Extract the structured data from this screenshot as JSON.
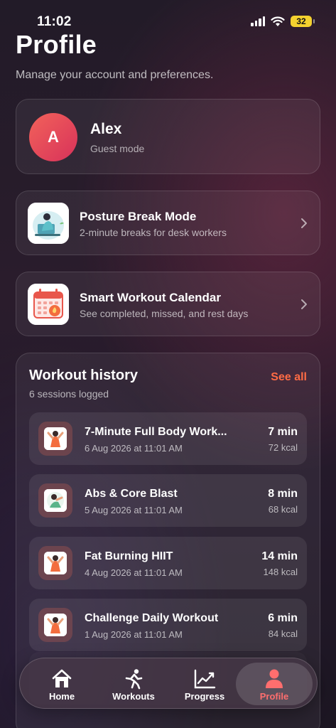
{
  "status_bar": {
    "time": "11:02",
    "battery": "32"
  },
  "header": {
    "title": "Profile",
    "subtitle": "Manage your account and preferences."
  },
  "profile": {
    "initial": "A",
    "name": "Alex",
    "status": "Guest mode"
  },
  "features": [
    {
      "title": "Posture Break Mode",
      "description": "2-minute breaks for desk workers",
      "icon": "posture-illustration-icon"
    },
    {
      "title": "Smart Workout Calendar",
      "description": "See completed, missed, and rest days",
      "icon": "calendar-icon"
    }
  ],
  "history": {
    "title": "Workout history",
    "count": "6 sessions logged",
    "see_all": "See all",
    "sessions": [
      {
        "name": "7-Minute Full Body Work...",
        "date": "6 Aug 2026 at 11:01 AM",
        "duration": "7 min",
        "kcal": "72 kcal"
      },
      {
        "name": "Abs & Core Blast",
        "date": "5 Aug 2026 at 11:01 AM",
        "duration": "8 min",
        "kcal": "68 kcal"
      },
      {
        "name": "Fat Burning HIIT",
        "date": "4 Aug 2026 at 11:01 AM",
        "duration": "14 min",
        "kcal": "148 kcal"
      },
      {
        "name": "Challenge Daily Workout",
        "date": "1 Aug 2026 at 11:01 AM",
        "duration": "6 min",
        "kcal": "84 kcal"
      }
    ]
  },
  "tabs": [
    {
      "label": "Home",
      "icon": "home-icon"
    },
    {
      "label": "Workouts",
      "icon": "running-icon"
    },
    {
      "label": "Progress",
      "icon": "chart-icon"
    },
    {
      "label": "Profile",
      "icon": "person-icon",
      "active": true
    }
  ],
  "colors": {
    "accent": "#ff6b45",
    "avatar_gradient_start": "#f2625a",
    "avatar_gradient_end": "#d8325a",
    "active_tab": "#ff6e6e"
  }
}
